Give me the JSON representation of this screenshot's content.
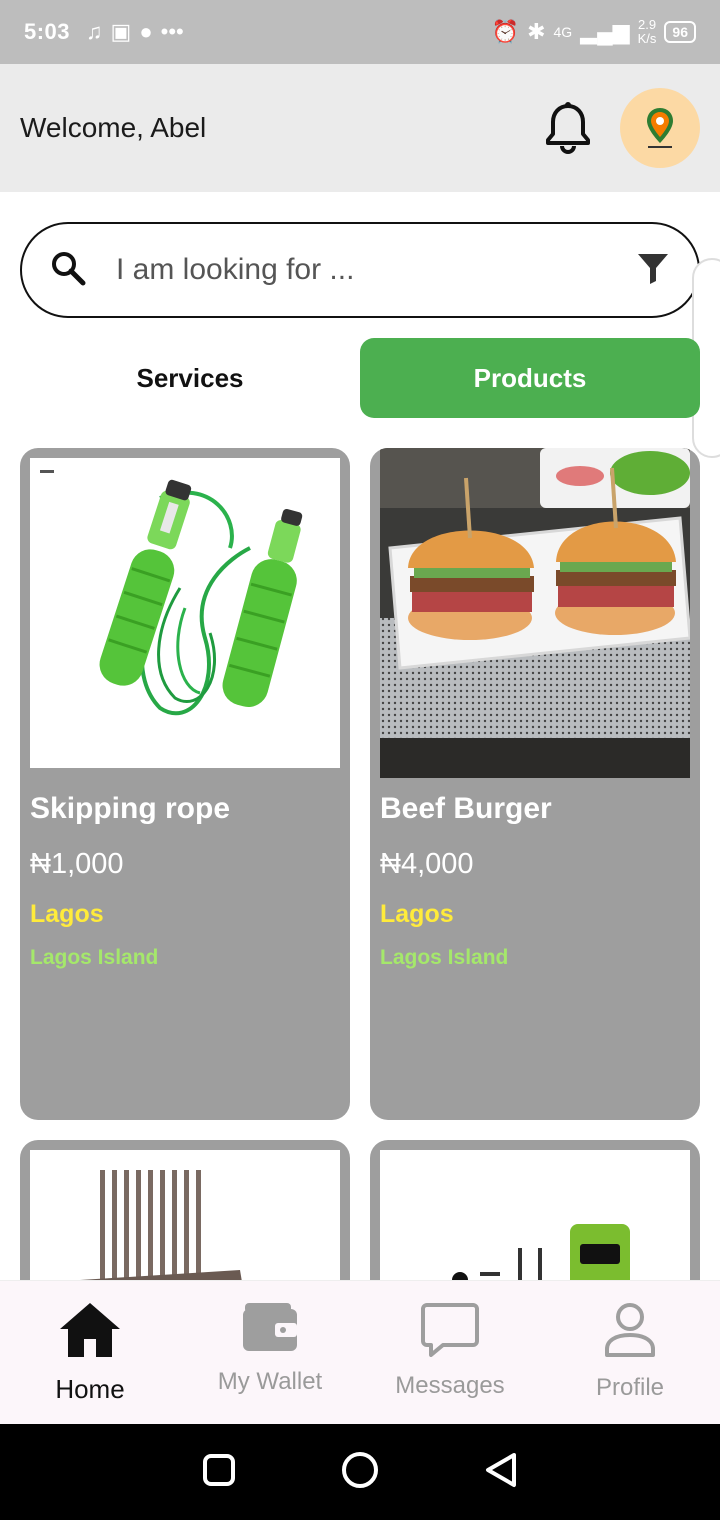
{
  "status_bar": {
    "time": "5:03",
    "network": "4G",
    "speed_value": "2.9",
    "speed_unit": "K/s",
    "battery": "96"
  },
  "header": {
    "welcome": "Welcome, Abel",
    "bell_icon": "bell-icon",
    "avatar_icon": "logo-avatar"
  },
  "search": {
    "placeholder": "I am looking for ...",
    "search_icon": "search-icon",
    "filter_icon": "filter-icon"
  },
  "tabs": [
    {
      "label": "Services",
      "active": false
    },
    {
      "label": "Products",
      "active": true
    }
  ],
  "products": [
    {
      "title": "Skipping rope",
      "price": "₦1,000",
      "state": "Lagos",
      "area": "Lagos Island",
      "image": "skipping-rope"
    },
    {
      "title": "Beef Burger",
      "price": "₦4,000",
      "state": "Lagos",
      "area": "Lagos Island",
      "image": "beef-burger"
    },
    {
      "title": "",
      "price": "",
      "state": "",
      "area": "",
      "image": "comb"
    },
    {
      "title": "",
      "price": "",
      "state": "",
      "area": "",
      "image": "oraimo-charger"
    }
  ],
  "bottom_nav": [
    {
      "label": "Home",
      "icon": "home-icon",
      "active": true
    },
    {
      "label": "My Wallet",
      "icon": "wallet-icon",
      "active": false
    },
    {
      "label": "Messages",
      "icon": "messages-icon",
      "active": false
    },
    {
      "label": "Profile",
      "icon": "profile-icon",
      "active": false
    }
  ],
  "colors": {
    "accent_green": "#4caf50",
    "card_grey": "#9e9e9e",
    "state_yellow": "#ffeb3b",
    "area_green": "#a5e86b"
  }
}
